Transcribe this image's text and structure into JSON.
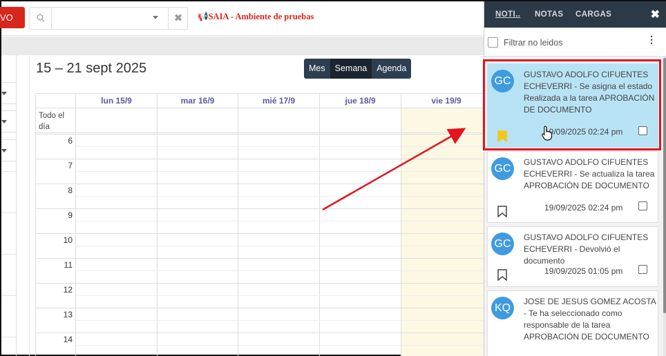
{
  "toolbar": {
    "new_label": "VO",
    "search_value": "",
    "environment": "SAIA - Ambiente de pruebas"
  },
  "calendar": {
    "title": "15 – 21 sept 2025",
    "views": [
      "Mes",
      "Semana",
      "Agenda"
    ],
    "active_view": "Semana",
    "days": [
      "lun 15/9",
      "mar 16/9",
      "mié 17/9",
      "jue 18/9",
      "vie 19/9"
    ],
    "today": "vie 19/9",
    "allday_label": "Todo el día",
    "hours": [
      "6",
      "7",
      "8",
      "9",
      "10",
      "11",
      "12",
      "13",
      "14"
    ]
  },
  "notifications": {
    "tabs": [
      "NOTI..",
      "NOTAS",
      "CARGAS"
    ],
    "active_tab": "NOTI..",
    "close_label": "✖",
    "filter_label": "Filtrar no leidos",
    "more_label": "⋮",
    "items": [
      {
        "initials": "GC",
        "text": "GUSTAVO ADOLFO CIFUENTES ECHEVERRI - Se asigna el estado Realizada a la tarea APROBACIÓN DE DOCUMENTO",
        "date": "19/09/2025 02:24 pm",
        "bookmarked": true,
        "selected": true
      },
      {
        "initials": "GC",
        "text": "GUSTAVO ADOLFO CIFUENTES ECHEVERRI - Se actualiza la tarea APROBACIÓN DE DOCUMENTO",
        "date": "19/09/2025 02:24 pm",
        "bookmarked": false,
        "selected": false
      },
      {
        "initials": "GC",
        "text": "GUSTAVO ADOLFO CIFUENTES ECHEVERRI - Devolvió el documento",
        "date": "19/09/2025 01:05 pm",
        "bookmarked": false,
        "selected": false
      },
      {
        "initials": "KQ",
        "text": "JOSE DE JESUS GOMEZ ACOSTA - Te ha seleccionado como responsable de la tarea APROBACIÓN DE DOCUMENTO",
        "date": "",
        "bookmarked": false,
        "selected": false
      }
    ]
  },
  "colors": {
    "brand_red": "#d9261c",
    "panel_header": "#2c3a47",
    "avatar_blue": "#3f9be0",
    "selected_card": "#b8e3f5",
    "today_column": "#fcf8e3",
    "bookmark_active": "#f5c518",
    "annotation_red": "#e3141e"
  }
}
